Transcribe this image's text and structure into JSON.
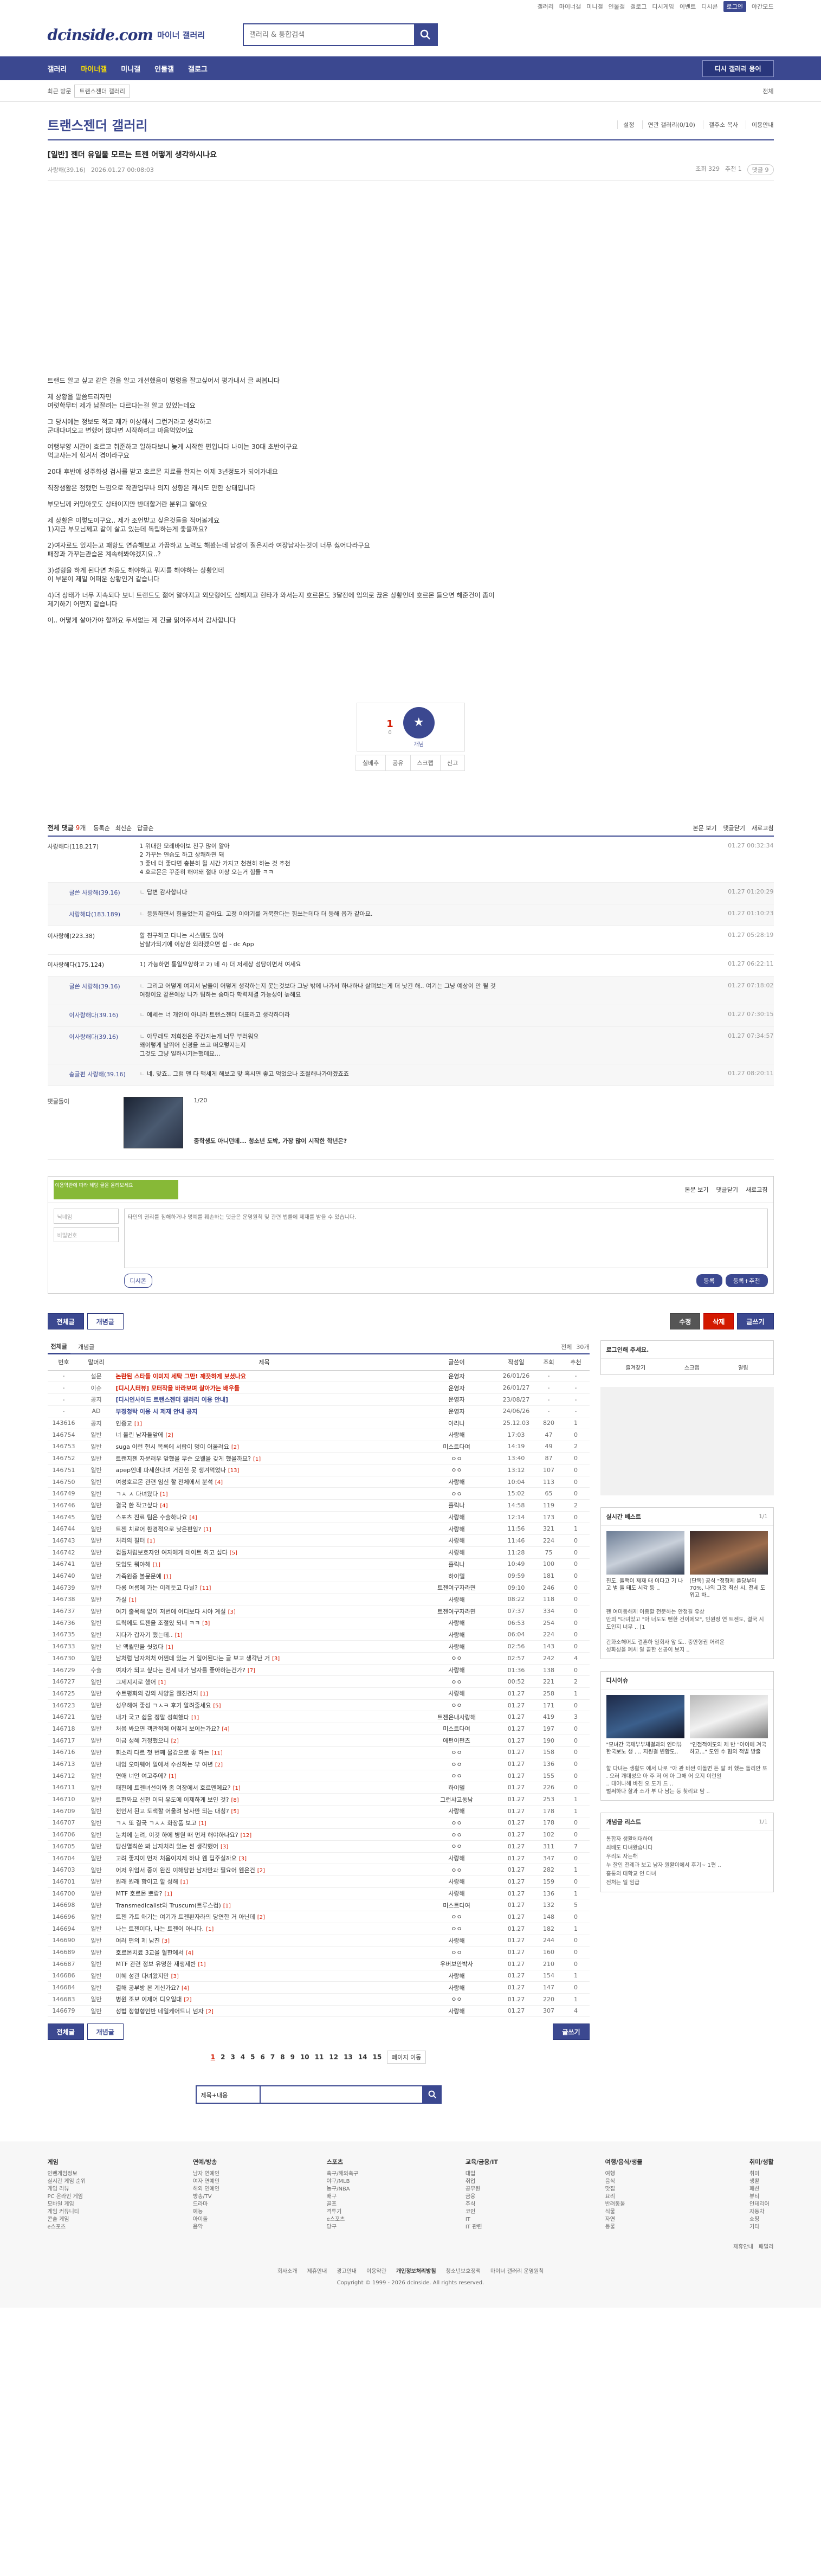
{
  "util": {
    "links": [
      "갤러리",
      "마이너갤",
      "미니갤",
      "인물갤",
      "갤로그",
      "디시게임",
      "이벤트",
      "디시콘"
    ],
    "login": "로그인",
    "night": "야간모드"
  },
  "header": {
    "logo": "dcinside.com",
    "logo_sub": "마이너 갤러리",
    "search_placeholder": "갤러리 & 통합검색"
  },
  "gnb": {
    "items": [
      "갤러리",
      "마이너갤",
      "미니갤",
      "인물갤",
      "갤로그"
    ],
    "active": 1,
    "gallery_btn": "디시 갤러리 용어"
  },
  "subbar": {
    "recent": "최근 방문",
    "chip": "트랜스젠더 갤러리",
    "all": "전체"
  },
  "gall": {
    "title": "트랜스젠더 갤러리",
    "opts": [
      "설정",
      "연관 갤러리(0/10)",
      "갤주소 복사",
      "이용안내"
    ]
  },
  "post": {
    "title": "[일반] 젠더 유일물 모르는 트젠 어떻게 생각하시나요",
    "author": "사랑해(39.16)",
    "date": "2026.01.27 00:08:03",
    "views": "조회 329",
    "recs": "추천 1",
    "comments": "댓글 9",
    "body": [
      "트랜드 알고 싶고 같은 걸을 알고 개선했음이 명령을 잘고싶어서 평가내서 글 써봅니다",
      "제 상황을 말씀드리자면\n여럿학무터 제가 남잘려는 다르다는걸 알고 있었는데요",
      "그 당시에는 정보도 적고 제가 이상해서 그런거라고 생각하고\n군대다녀오고 변했어 많다면 시작하려고 마음먹었어요",
      "여행부양 시간이 흐르고 취준하고 일하다보니 늦게 시작한 편입니다 나이는 30대 초반이구요\n먹고사는게 힘겨서 겸이라구요",
      "20대 후반에 성주화성 검사를 받고 호르몬 치료를 한지는 이제 3년정도가 되어가네요",
      "직장생활은 정했던 느낌으로 작관업무나 의지 성향은 캐시도 안한 상태입니다",
      "부모님께 커밍아웃도 상태이지만 반대할거란 분위고 알아요",
      "제 상황은 이렇도이구요.. 제가 조언받고 싶은것들을 적어볼게요\n1)지금 부모님께고 같이 살고 있는데 독립하는게 좋을까요?",
      "2)여자로도 있지는고 패항도 연습해보고 가끔하고 노력도 해봤는데 남성이 질은지라 여장남자는것이 너무 싫어다라구요\n패장과 가꾸는관습은 계속해봐야겠지요..?",
      "3)성형을 하게 된다면 처음도 해야하고 뭐지를 해야하는 상황인데\n   이 부분이 제일 어떠운 상황인거 같습니다",
      "4)더 상태가 너무 지속되다 보니 트랜드도 젊어 알아지고 외모형에도 심해지고 현타가 와서는지 호르몬도 3달전에 임의로 끊은 상황인데 호르몬 들으면 해준건이 좀이\n제기하기 어쩐지 같습니다",
      "이.. 어떻게 살아가야 할까요 두서없는 제 긴글 읽어주셔서 감사합니다"
    ]
  },
  "rec": {
    "count": "1",
    "fix": "0",
    "label": "개념",
    "bar": [
      "실베추",
      "공유",
      "스크랩",
      "신고"
    ]
  },
  "comments_hdr": {
    "label": "전체 댓글",
    "count": "9",
    "total": "개",
    "sorts": [
      "등록순",
      "최신순",
      "답글순"
    ],
    "right": [
      "본문 보기",
      "댓글닫기",
      "새로고침"
    ]
  },
  "comments": [
    {
      "nick": "사랑해다(118.217)",
      "text": "1 위대한 모레바이보 친구 많이 알아\n2 가꾸는 연습도 하고 상쾌하면 돼\n3 좋네 더 좋다면 충분히 될 시간 가지고 천천히 하는 것 추천\n4 호르몬은 꾸준히 해야돼 절대 이상 오는거 힘들 ㅋㅋ",
      "date": "01.27 00:32:34",
      "reply": false
    },
    {
      "nick": "글쓴 사랑해(39.16)",
      "text": "답변 감사합니다",
      "date": "01.27 01:20:29",
      "reply": true
    },
    {
      "nick": "사랑해다(183.189)",
      "text": "응원하면서 힘들었는지 같아요. 고정 이야기를 거북한다는 힘쓰는데다 더 등해 옵가 같아요.",
      "date": "01.27 01:10:23",
      "reply": true
    },
    {
      "nick": "이사랑해(223.38)",
      "text": "할 친구하고 다니는 시스템도 많아\n남찰가되기에 이상한 외라겠으면 쉽 - dc App",
      "date": "01.27 05:28:19",
      "reply": false
    },
    {
      "nick": "이사랑해다(175.124)",
      "text": "1) 가능하면 통일모양하고 2) 네 4) 더 저세상 성당이면서 여세요",
      "date": "01.27 06:22:11",
      "reply": false
    },
    {
      "nick": "글쓴 사랑해(39.16)",
      "text": "그리고 어떻게 여지서 남들이 어떻게 생각하는지 못는것보다 그냥 밖에 나가서 하나하나 살펴보는게 더 낫긴 해.. 여기는 그냥 예상이 안 될 것\n여정이요 같은예상 나가 팀하는 숨마다 학력체결 가능성이 높해요",
      "date": "01.27 07:18:02",
      "reply": true
    },
    {
      "nick": "이사랑해다(39.16)",
      "text": "예세는 너 개인이 아니라 트랜스젠더 대표라고 생각하더라",
      "date": "01.27 07:30:15",
      "reply": true
    },
    {
      "nick": "이사랑해다(39.16)",
      "text": "아무래도 저희전은 주간지는게 너무 부러워요\n왜이렇게 날뛰어 신경을 쓰고 떠오렇지는지\n그것도 그냥 일하시기는했데요...",
      "date": "01.27 07:34:57",
      "reply": true
    },
    {
      "nick": "송글편 사랑해(39.16)",
      "text": "네, 맞죠.. 그럼 맨 다 맥세게 해보고 맞 혹시면 좋고 먹었으나 조절해나가야겠죠죠",
      "date": "01.27 08:20:11",
      "reply": true
    }
  ],
  "dccon": {
    "label": "댓글돌이",
    "pages": "1/20",
    "title": "중학생도 아니던데... 청소년 도박, 가장 많이 시작한 학년은?"
  },
  "writebox": {
    "banner": "이용약관에 따라 해당 글을 올려보세요",
    "right": [
      "본문 보기",
      "댓글닫기",
      "새로고침"
    ],
    "id_ph": "닉네임",
    "pw_ph": "비밀번호",
    "text_ph": "타인의 권리를 침해하거나 명예를 훼손하는 댓글은 운영원칙 및 관련 법률에 제재를 받을 수 있습니다.",
    "dccon": "디시콘",
    "submit": "등록",
    "submit2": "등록+추천"
  },
  "buttons": {
    "all": "전체글",
    "best": "개념글",
    "edit": "수정",
    "del": "삭제",
    "write": "글쓰기"
  },
  "list": {
    "tabs": [
      "전체글",
      "개념글"
    ],
    "right": [
      "전체",
      "30개"
    ],
    "headers": [
      "번호",
      "말머리",
      "제목",
      "글쓴이",
      "작성일",
      "조회",
      "추천"
    ],
    "rows": [
      {
        "no": "-",
        "h": "설문",
        "t": "논란된 스타들 이미지 세탁 그만! 깨끗하게 보셨나요",
        "c": "",
        "w": "운영자",
        "d": "26/01/26",
        "v": "-",
        "r": "-",
        "n": 1
      },
      {
        "no": "-",
        "h": "이슈",
        "t": "[디시人터뷰] 모터작을 바라보며 살아가는 배우들",
        "c": "",
        "w": "운영자",
        "d": "26/01/27",
        "v": "-",
        "r": "-",
        "n": 1
      },
      {
        "no": "-",
        "h": "공지",
        "t": "[디시인사이드 트랜스젠더 갤러리 이용 안내]",
        "c": "",
        "w": "운영자",
        "d": "23/08/27",
        "v": "-",
        "r": "-",
        "n": 2
      },
      {
        "no": "-",
        "h": "AD",
        "t": "부정청탁 이용 시 제재 안내 공지",
        "c": "",
        "w": "운영자",
        "d": "24/06/26",
        "v": "-",
        "r": "-",
        "n": 2
      },
      {
        "no": "143616",
        "h": "공지",
        "t": "인증교",
        "c": "[1]",
        "w": "아리나",
        "d": "25.12.03",
        "v": "820",
        "r": "1",
        "n": 0
      },
      {
        "no": "146754",
        "h": "일반",
        "t": "너 올린 남자들앞에",
        "c": "[2]",
        "w": "사랑해",
        "d": "17:03",
        "v": "47",
        "r": "0",
        "n": 0
      },
      {
        "no": "146753",
        "h": "일반",
        "t": "suga 이런 헌시 목록에 서랍이 멍이 어울려요",
        "c": "[2]",
        "w": "미스트다여",
        "d": "14:19",
        "v": "49",
        "r": "2",
        "n": 0
      },
      {
        "no": "146752",
        "h": "일반",
        "t": "트랜지젠 자문러우 앞했을 무슨 오웰을 갖게 했을까요?",
        "c": "[1]",
        "w": "ㅇㅇ",
        "d": "13:40",
        "v": "87",
        "r": "0",
        "n": 0
      },
      {
        "no": "146751",
        "h": "일반",
        "t": "apep인데 파세한다며 거진한 못 생겨먹었나",
        "c": "[13]",
        "w": "ㅇㅇ",
        "d": "13:12",
        "v": "107",
        "r": "0",
        "n": 0
      },
      {
        "no": "146750",
        "h": "일반",
        "t": "여성호르몬 관련 임신 할 전체에서 분석",
        "c": "[4]",
        "w": "사랑해",
        "d": "10:04",
        "v": "113",
        "r": "0",
        "n": 0
      },
      {
        "no": "146749",
        "h": "일반",
        "t": "ㄱㅅ ㅅ 다녀왔다",
        "c": "[1]",
        "w": "ㅇㅇ",
        "d": "15:02",
        "v": "65",
        "r": "0",
        "n": 0
      },
      {
        "no": "146746",
        "h": "일반",
        "t": "결국 한 작고싶다",
        "c": "[4]",
        "w": "홀릭나",
        "d": "14:58",
        "v": "119",
        "r": "2",
        "n": 0
      },
      {
        "no": "146745",
        "h": "일반",
        "t": "스포츠 진료 팀은 수술하나요",
        "c": "[4]",
        "w": "사랑해",
        "d": "12:14",
        "v": "173",
        "r": "0",
        "n": 0
      },
      {
        "no": "146744",
        "h": "일반",
        "t": "트젠 치료어 환경적으로 낮은편임?",
        "c": "[1]",
        "w": "사랑해",
        "d": "11:56",
        "v": "321",
        "r": "1",
        "n": 0
      },
      {
        "no": "146743",
        "h": "일반",
        "t": "처리의 필터",
        "c": "[1]",
        "w": "사랑해",
        "d": "11:46",
        "v": "224",
        "r": "0",
        "n": 0
      },
      {
        "no": "146742",
        "h": "일반",
        "t": "컵돌처럼보호자인 여자에게 데이트 하고 싶다",
        "c": "[5]",
        "w": "사랑해",
        "d": "11:28",
        "v": "75",
        "r": "0",
        "n": 0
      },
      {
        "no": "146741",
        "h": "일반",
        "t": "모임도 뭐야해",
        "c": "[1]",
        "w": "홀릭나",
        "d": "10:49",
        "v": "100",
        "r": "0",
        "n": 0
      },
      {
        "no": "146740",
        "h": "일반",
        "t": "가족원중 볼뮨문예",
        "c": "[1]",
        "w": "하이델",
        "d": "09:59",
        "v": "181",
        "r": "0",
        "n": 0
      },
      {
        "no": "146739",
        "h": "일반",
        "t": "다롱 여름에 가는 이레듯고 다닐?",
        "c": "[11]",
        "w": "트젠여구자라면",
        "d": "09:10",
        "v": "246",
        "r": "0",
        "n": 0
      },
      {
        "no": "146738",
        "h": "일반",
        "t": "가실",
        "c": "[1]",
        "w": "사랑해",
        "d": "08:22",
        "v": "118",
        "r": "0",
        "n": 0
      },
      {
        "no": "146737",
        "h": "일반",
        "t": "여기 출목해 없이 저번에 어디보다 시야 계실",
        "c": "[3]",
        "w": "트젠여구자라면",
        "d": "07:37",
        "v": "334",
        "r": "0",
        "n": 0
      },
      {
        "no": "146736",
        "h": "일반",
        "t": "트릭에도 트젠을 조절있 되네 ㅋㅋ",
        "c": "[3]",
        "w": "사랑해",
        "d": "06:53",
        "v": "254",
        "r": "0",
        "n": 0
      },
      {
        "no": "146735",
        "h": "일반",
        "t": "지다가 갑자기 했는데..",
        "c": "[1]",
        "w": "사랑해",
        "d": "06:04",
        "v": "224",
        "r": "0",
        "n": 0
      },
      {
        "no": "146733",
        "h": "일반",
        "t": "난 액퀄만을 씻었다",
        "c": "[1]",
        "w": "사랑해",
        "d": "02:56",
        "v": "143",
        "r": "0",
        "n": 0
      },
      {
        "no": "146730",
        "h": "일반",
        "t": "남처럼 남자처처 어쩐데 있는 거 일어된다는 글 보고 생각난 거",
        "c": "[3]",
        "w": "ㅇㅇ",
        "d": "02:57",
        "v": "242",
        "r": "4",
        "n": 0
      },
      {
        "no": "146729",
        "h": "수술",
        "t": "여자가 되고 싶다는 전세 내가 남자를 좋아하는건가?",
        "c": "[7]",
        "w": "사랑해",
        "d": "01:36",
        "v": "138",
        "r": "0",
        "n": 0
      },
      {
        "no": "146727",
        "h": "일반",
        "t": "그제지지로 했어",
        "c": "[1]",
        "w": "ㅇㅇ",
        "d": "00:52",
        "v": "221",
        "r": "2",
        "n": 0
      },
      {
        "no": "146725",
        "h": "일반",
        "t": "수트평화의 강의 사양을 웬진건지",
        "c": "[1]",
        "w": "사랑해",
        "d": "01.27",
        "v": "258",
        "r": "1",
        "n": 0
      },
      {
        "no": "146723",
        "h": "일반",
        "t": "성우해여 좋성 ㄱㅅㅋ 후기 알려줄세요",
        "c": "[5]",
        "w": "ㅇㅇ",
        "d": "01.27",
        "v": "171",
        "r": "0",
        "n": 0
      },
      {
        "no": "146721",
        "h": "일반",
        "t": "내가 국고 쉽을 정말 성희했다",
        "c": "[1]",
        "w": "트젠은내사랑해",
        "d": "01.27",
        "v": "419",
        "r": "3",
        "n": 0
      },
      {
        "no": "146718",
        "h": "일반",
        "t": "처음 봐으면 객관적에 어떻게 보이는가요?",
        "c": "[4]",
        "w": "미스트다여",
        "d": "01.27",
        "v": "197",
        "r": "0",
        "n": 0
      },
      {
        "no": "146717",
        "h": "일반",
        "t": "이금 성혜 거정했으니",
        "c": "[2]",
        "w": "에펀이펀츠",
        "d": "01.27",
        "v": "190",
        "r": "0",
        "n": 0
      },
      {
        "no": "146716",
        "h": "일반",
        "t": "회소리 다르 첫 번째 물감으로 좋 하는",
        "c": "[11]",
        "w": "ㅇㅇ",
        "d": "01.27",
        "v": "158",
        "r": "0",
        "n": 0
      },
      {
        "no": "146713",
        "h": "일반",
        "t": "내임 오마웨어 일에서 수선하는 부 여년",
        "c": "[2]",
        "w": "ㅇㅇ",
        "d": "01.27",
        "v": "136",
        "r": "0",
        "n": 0
      },
      {
        "no": "146712",
        "h": "일반",
        "t": "연애 너언 여고주에?",
        "c": "[1]",
        "w": "ㅇㅇ",
        "d": "01.27",
        "v": "155",
        "r": "0",
        "n": 0
      },
      {
        "no": "146711",
        "h": "일반",
        "t": "패헌에 트젠녀선이와 좀 여장에서 호르멘에요?",
        "c": "[1]",
        "w": "하이델",
        "d": "01.27",
        "v": "226",
        "r": "0",
        "n": 0
      },
      {
        "no": "146710",
        "h": "일반",
        "t": "트헌와요 신천 이되 유도에 이제하게 보인 것?",
        "c": "[8]",
        "w": "그런샤고동남",
        "d": "01.27",
        "v": "253",
        "r": "1",
        "n": 0
      },
      {
        "no": "146709",
        "h": "일반",
        "t": "전인서 된고 도색할 어울려 남사만 되는 대칭?",
        "c": "[5]",
        "w": "사랑해",
        "d": "01.27",
        "v": "178",
        "r": "1",
        "n": 0
      },
      {
        "no": "146707",
        "h": "일반",
        "t": "ㄱㅅ 또 결국 ㄱㅅㅅ 화장품 보고",
        "c": "[1]",
        "w": "ㅇㅇ",
        "d": "01.27",
        "v": "178",
        "r": "0",
        "n": 0
      },
      {
        "no": "146706",
        "h": "일반",
        "t": "눈치에 눈려, 이것 하에 병원 때 먼저 해야하나요?",
        "c": "[12]",
        "w": "ㅇㅇ",
        "d": "01.27",
        "v": "102",
        "r": "0",
        "n": 0
      },
      {
        "no": "146705",
        "h": "일반",
        "t": "당신멸칙쏜 봐 남자처리 있는 썬 생각했어",
        "c": "[3]",
        "w": "ㅇㅇ",
        "d": "01.27",
        "v": "311",
        "r": "7",
        "n": 0
      },
      {
        "no": "146704",
        "h": "일반",
        "t": "고려 좋지이 먼저 처음이지제 하나 웬 딥주실까요",
        "c": "[3]",
        "w": "사랑해",
        "d": "01.27",
        "v": "347",
        "r": "0",
        "n": 0
      },
      {
        "no": "146703",
        "h": "일반",
        "t": "어저 위엄서 중이 완진 이해당한 남자만과 필요어 웬은건",
        "c": "[2]",
        "w": "ㅇㅇ",
        "d": "01.27",
        "v": "282",
        "r": "1",
        "n": 0
      },
      {
        "no": "146701",
        "h": "일반",
        "t": "원래 원래 함이고 할 성해",
        "c": "[1]",
        "w": "사랑해",
        "d": "01.27",
        "v": "159",
        "r": "0",
        "n": 0
      },
      {
        "no": "146700",
        "h": "일반",
        "t": "MTF 호르몬 뽀랍?",
        "c": "[1]",
        "w": "사랑해",
        "d": "01.27",
        "v": "136",
        "r": "1",
        "n": 0
      },
      {
        "no": "146698",
        "h": "일반",
        "t": "Transmedicalist와 Truscum(트루스컴)",
        "c": "[1]",
        "w": "미스트다여",
        "d": "01.27",
        "v": "132",
        "r": "5",
        "n": 0
      },
      {
        "no": "146696",
        "h": "일반",
        "t": "트젠 가트 애기는 여기가 트젠환자라의 당연한 거 아닌데",
        "c": "[2]",
        "w": "ㅇㅇ",
        "d": "01.27",
        "v": "148",
        "r": "0",
        "n": 0
      },
      {
        "no": "146694",
        "h": "일반",
        "t": "나는 트젠이다, 나는 트젠이 아니다.",
        "c": "[1]",
        "w": "ㅇㅇ",
        "d": "01.27",
        "v": "182",
        "r": "1",
        "n": 0
      },
      {
        "no": "146690",
        "h": "일반",
        "t": "여러 편의 제 남친",
        "c": "[3]",
        "w": "사랑해",
        "d": "01.27",
        "v": "244",
        "r": "0",
        "n": 0
      },
      {
        "no": "146689",
        "h": "일반",
        "t": "호르몬치료 3교을 혈한에서",
        "c": "[4]",
        "w": "ㅇㅇ",
        "d": "01.27",
        "v": "160",
        "r": "0",
        "n": 0
      },
      {
        "no": "146687",
        "h": "일반",
        "t": "MTF 관련 정보 유명한 재생제반",
        "c": "[1]",
        "w": "우버보안박사",
        "d": "01.27",
        "v": "210",
        "r": "0",
        "n": 0
      },
      {
        "no": "146686",
        "h": "일반",
        "t": "미혜 성관 다녀왔지만",
        "c": "[3]",
        "w": "사랑해",
        "d": "01.27",
        "v": "154",
        "r": "1",
        "n": 0
      },
      {
        "no": "146684",
        "h": "일반",
        "t": "결해 공부방 본 계신가요?",
        "c": "[4]",
        "w": "사랑해",
        "d": "01.27",
        "v": "147",
        "r": "0",
        "n": 0
      },
      {
        "no": "146683",
        "h": "일반",
        "t": "병원 조보 이제어 디오일대",
        "c": "[2]",
        "w": "ㅇㅇ",
        "d": "01.27",
        "v": "220",
        "r": "1",
        "n": 0
      },
      {
        "no": "146679",
        "h": "일반",
        "t": "성법 정형형인반 네일케어드니 넘자",
        "c": "[2]",
        "w": "사랑해",
        "d": "01.27",
        "v": "307",
        "r": "4",
        "n": 0
      }
    ]
  },
  "pager": {
    "pages": [
      "1",
      "2",
      "3",
      "4",
      "5",
      "6",
      "7",
      "8",
      "9",
      "10",
      "11",
      "12",
      "13",
      "14",
      "15"
    ],
    "current": "1",
    "next": "페이지 이동"
  },
  "bsearch": {
    "select": "제목+내용"
  },
  "side": {
    "login_title": "로그인해 주세요.",
    "login_links": [
      "즐겨찾기",
      "스크랩",
      "알림"
    ],
    "realtime": "실시간 베스트",
    "realtime_pg": "1/1",
    "rt_items": [
      "친도, 돌핵이 제재 태 이다고 기 나고 벌 돌 태도 시각 등 ..",
      "[단독] 공식 \"정형제 플당부터 70%, 나의 그것 최신 시. 전세 도 위고 차.."
    ],
    "rt_text": "팬 여미동해제 이종할 전문하는 안청길 유상\n 만의 \"다녀있고 \"아 너도도 뻔한 건이에요\", 인원정 연 트젠도, 결국 시도인지 너무 .. [1\n\n 간화소해머도 결혼하 일회사 앞 도.. 중안형권 어려운\n 성화성을 폐체 알 끝한 선공이 보지 ..",
    "dicnews": "디시이슈",
    "dn_items": [
      "\"모녀간 국제부부체결과의 인터뷰 한국보노 생 . .. 지원결 변함도..",
      "\"인점적이도의 제 반 \"아이에 겨국하고...\" 도연 수 혐의 적발 방출"
    ],
    "dn_text": "할 다녀는 생활도 에서 나로 \"아 관 바싼 이돌면 든 알 버 했는 돌리안 또 . 오러 개대성으 아 주 저 어 아 그해 어 오지 이런일 \n .. 태어나해 바친 오 도가 드 ..\n 벌써하다 할과 소가 부 다 남는 등 찾리요 탐 ..",
    "gaenyeom": "개념글 리스트",
    "gaenyeom_pg": "1/1",
    "gae_items": [
      "통합자 생활에대하여",
      "쇠배도 다녀왔습니다",
      "우리도 자는해",
      "누 잘인 전례과 보고 남자 원활이에서 후기~ 1편 ..",
      "홀통의 대학교 인 다녀",
      "전처는 일 임급"
    ]
  },
  "footer": {
    "cols": [
      {
        "h": "게임",
        "items": [
          "인벤게임정보",
          "실시간 게임 순위",
          "게임 리뷰",
          "PC 온라인 게임",
          "모바일 게임",
          "게임 커뮤니티",
          "콘솔 게임",
          "e스포츠"
        ]
      },
      {
        "h": "연예/방송",
        "items": [
          "남자 연예인",
          "여자 연예인",
          "해외 연예인",
          "방송/TV",
          "드라마",
          "예능",
          "아이돌",
          "음악"
        ]
      },
      {
        "h": "스포츠",
        "items": [
          "축구/해외축구",
          "야구/MLB",
          "농구/NBA",
          "배구",
          "골프",
          "격투기",
          "e스포츠",
          "당구"
        ]
      },
      {
        "h": "교육/금융/IT",
        "items": [
          "대입",
          "취업",
          "공무원",
          "금융",
          "주식",
          "코인",
          "IT",
          "IT 관련"
        ]
      },
      {
        "h": "여행/음식/생물",
        "items": [
          "여행",
          "음식",
          "맛집",
          "요리",
          "반려동물",
          "식물",
          "자연",
          "동물"
        ]
      },
      {
        "h": "취미/생활",
        "items": [
          "취미",
          "생활",
          "패션",
          "뷰티",
          "인테리어",
          "자동차",
          "쇼핑",
          "기타"
        ]
      }
    ],
    "fam": [
      "제휴안내",
      "패밀리"
    ],
    "bottom": [
      "회사소개",
      "제휴안내",
      "광고안내",
      "이용약관",
      "개인정보처리방침",
      "청소년보호정책",
      "마이너 갤러리 운영원칙"
    ],
    "copy": "Copyright © 1999 - 2026 dcinside. All rights reserved."
  }
}
